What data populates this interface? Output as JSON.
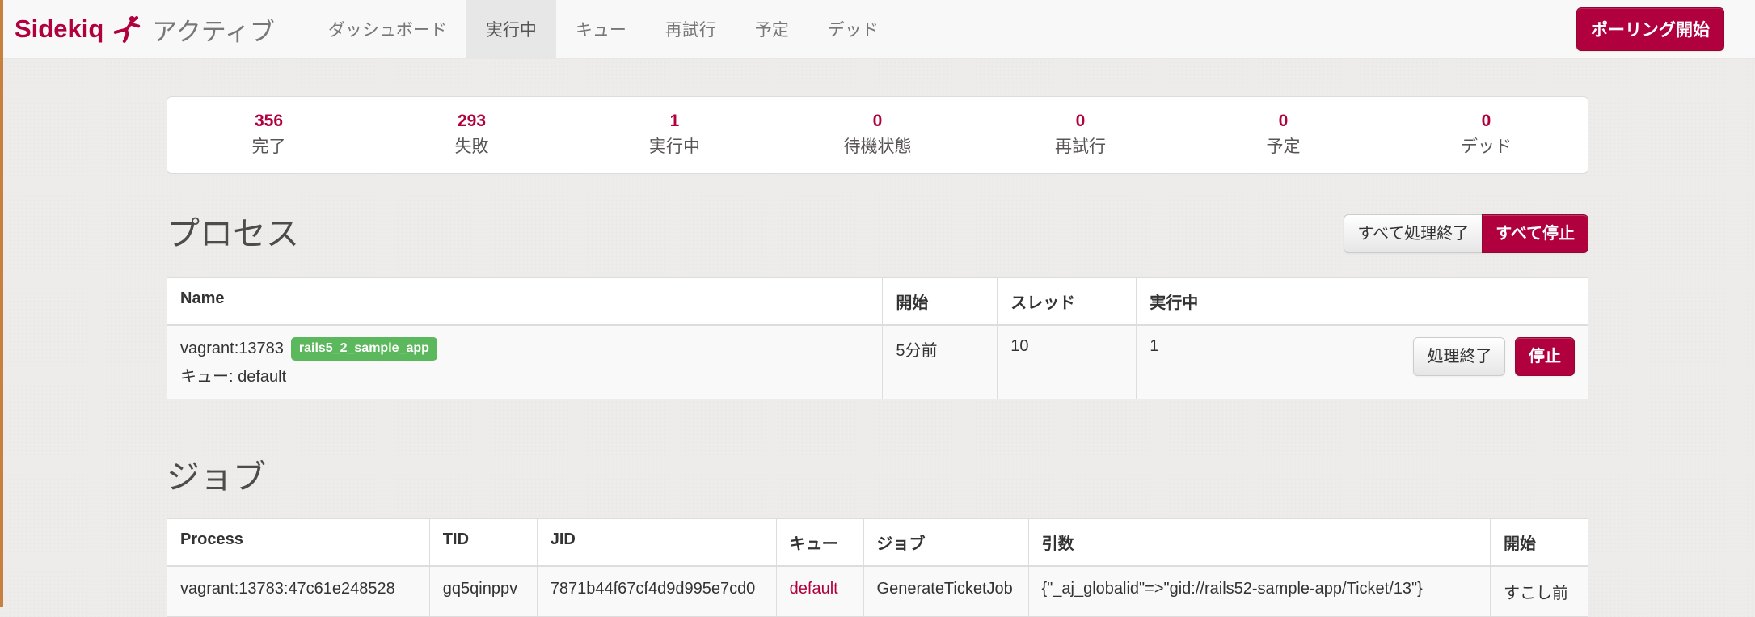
{
  "colors": {
    "accent": "#b1003e",
    "badge_green": "#5cb85c",
    "navbar_bg": "#f8f8f8",
    "active_tab_bg": "#e7e7e7",
    "page_bg": "#edecea"
  },
  "navbar": {
    "brand": "Sidekiq",
    "status": "アクティブ",
    "tabs": [
      {
        "label": "ダッシュボード",
        "active": false
      },
      {
        "label": "実行中",
        "active": true
      },
      {
        "label": "キュー",
        "active": false
      },
      {
        "label": "再試行",
        "active": false
      },
      {
        "label": "予定",
        "active": false
      },
      {
        "label": "デッド",
        "active": false
      }
    ],
    "polling_button": "ポーリング開始"
  },
  "stats": [
    {
      "value": "356",
      "label": "完了"
    },
    {
      "value": "293",
      "label": "失敗"
    },
    {
      "value": "1",
      "label": "実行中"
    },
    {
      "value": "0",
      "label": "待機状態"
    },
    {
      "value": "0",
      "label": "再試行"
    },
    {
      "value": "0",
      "label": "予定"
    },
    {
      "value": "0",
      "label": "デッド"
    }
  ],
  "processes": {
    "heading": "プロセス",
    "quiet_all_button": "すべて処理終了",
    "stop_all_button": "すべて停止",
    "headers": {
      "name": "Name",
      "started": "開始",
      "threads": "スレッド",
      "busy": "実行中"
    },
    "row": {
      "name": "vagrant:13783",
      "tag": "rails5_2_sample_app",
      "queues_label": "キュー:",
      "queues": "default",
      "started": "5分前",
      "threads": "10",
      "busy": "1",
      "quiet_button": "処理終了",
      "stop_button": "停止"
    }
  },
  "jobs": {
    "heading": "ジョブ",
    "headers": {
      "process": "Process",
      "tid": "TID",
      "jid": "JID",
      "queue": "キュー",
      "job": "ジョブ",
      "args": "引数",
      "started": "開始"
    },
    "row": {
      "process": "vagrant:13783:47c61e248528",
      "tid": "gq5qinppv",
      "jid": "7871b44f67cf4d9d995e7cd0",
      "queue": "default",
      "job": "GenerateTicketJob",
      "args": "{\"_aj_globalid\"=>\"gid://rails52-sample-app/Ticket/13\"}",
      "started": "すこし前"
    }
  }
}
